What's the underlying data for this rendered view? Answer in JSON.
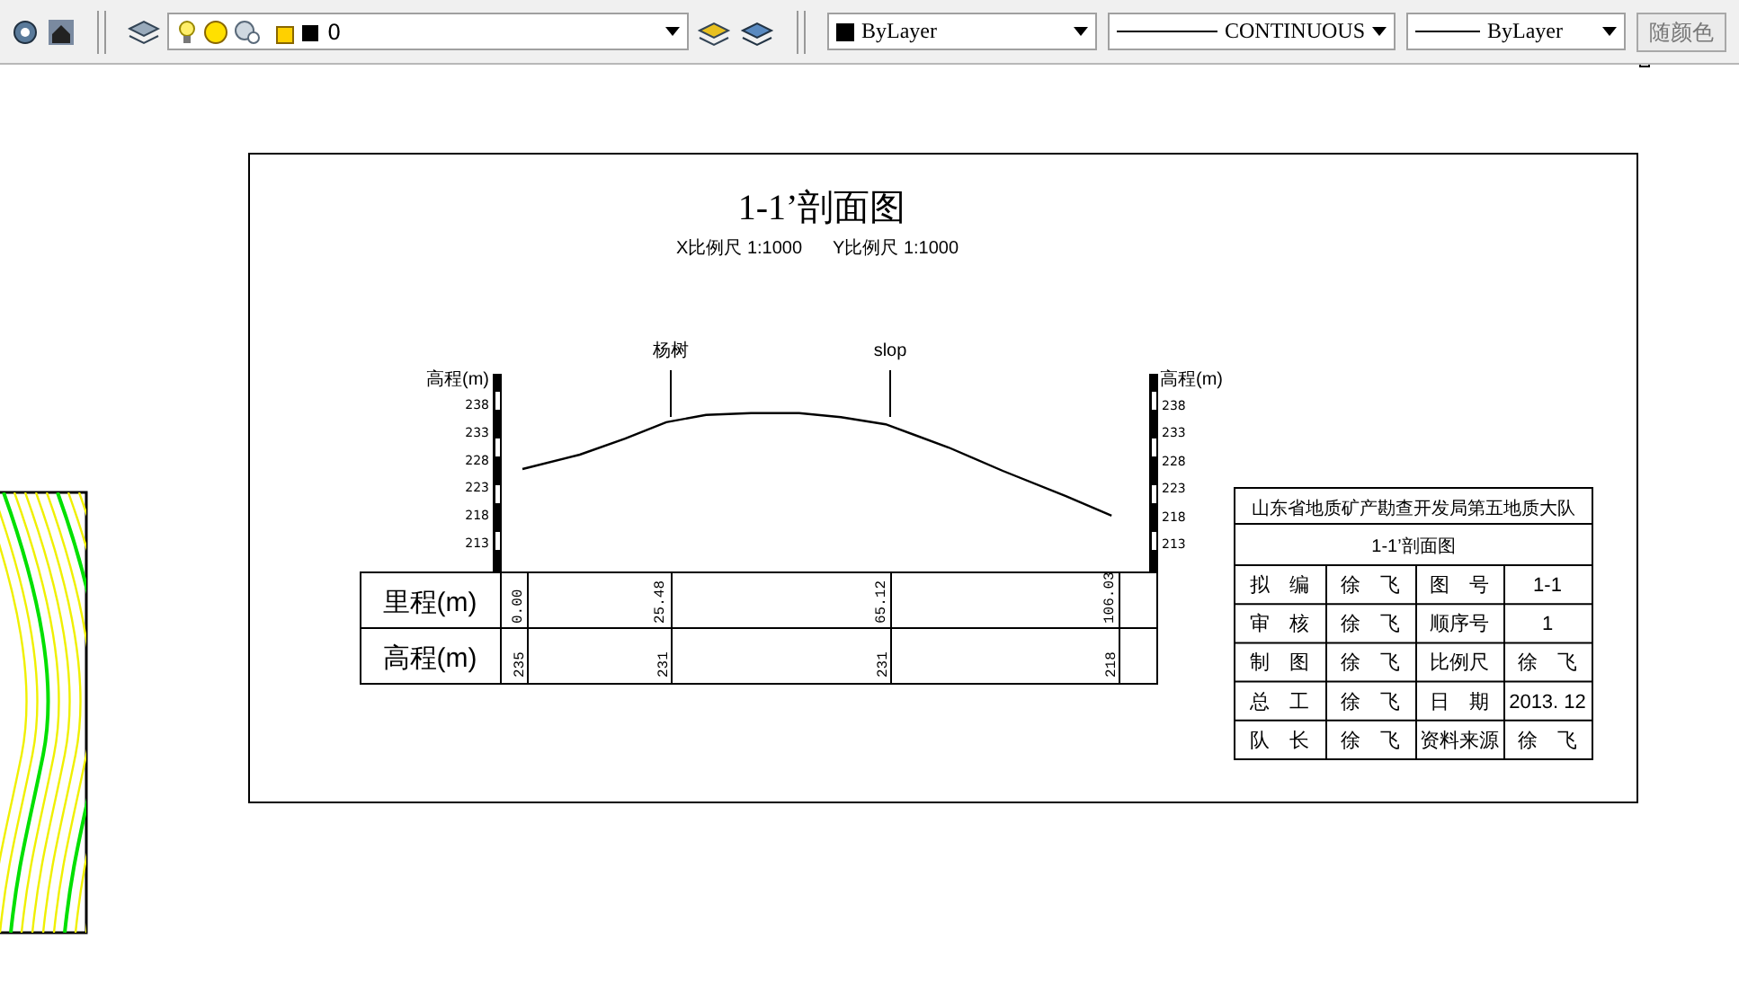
{
  "toolbar": {
    "layer_dropdown": {
      "value": "0"
    },
    "color_dropdown": {
      "value": "ByLayer"
    },
    "linetype_dropdown": {
      "value": "CONTINUOUS"
    },
    "lineweight_dropdown": {
      "value": "ByLayer"
    },
    "plot_style_button": "随颜色"
  },
  "drawing": {
    "title": "1-1’剖面图",
    "scales": [
      "X比例尺  1:1000",
      "Y比例尺  1:1000"
    ],
    "markers": [
      "杨树",
      "slop"
    ],
    "chart_data": {
      "type": "line",
      "ylabel": "高程(m)",
      "xlabel": "里程(m)",
      "ylim": [
        213,
        238
      ],
      "xlim": [
        -28.68,
        114.1
      ],
      "yticks": [
        213,
        218,
        223,
        228,
        233,
        238
      ],
      "xticks": [
        {
          "value": 0,
          "label": "0.00"
        },
        {
          "value": 25.48,
          "label": "25.48"
        },
        {
          "value": 65.12,
          "label": "65.12"
        },
        {
          "value": 106.03,
          "label": "106.03"
        }
      ],
      "x": [
        0,
        10.3,
        18.4,
        25.8,
        32.9,
        41.0,
        49.6,
        57.1,
        65.1,
        76.4,
        86.1,
        97.4,
        105.6
      ],
      "series": [
        {
          "color": "#000000",
          "values": [
            226.3,
            228.9,
            231.8,
            234.8,
            236.1,
            236.4,
            236.4,
            235.7,
            234.4,
            230.2,
            226.0,
            221.4,
            217.9
          ]
        }
      ]
    },
    "right_axis": {
      "label": "高程(m)",
      "ticks": [
        "238",
        "233",
        "228",
        "223",
        "218",
        "213"
      ]
    },
    "elevation_row": {
      "label": "高程(m)",
      "values": [
        "235",
        "231",
        "231",
        "218"
      ]
    },
    "title_block": {
      "organization": "山东省地质矿产勘查开发局第五地质大队",
      "drawing_name": "1-1’剖面图",
      "rows": [
        [
          "拟　编",
          "徐　飞",
          "图　号",
          "1-1"
        ],
        [
          "审　核",
          "徐　飞",
          "顺序号",
          "1"
        ],
        [
          "制　图",
          "徐　飞",
          "比例尺",
          "徐　飞"
        ],
        [
          "总　工",
          "徐　飞",
          "日　期",
          "2013. 12"
        ],
        [
          "队　长",
          "徐　飞",
          "资料来源",
          "徐　飞"
        ]
      ]
    }
  }
}
